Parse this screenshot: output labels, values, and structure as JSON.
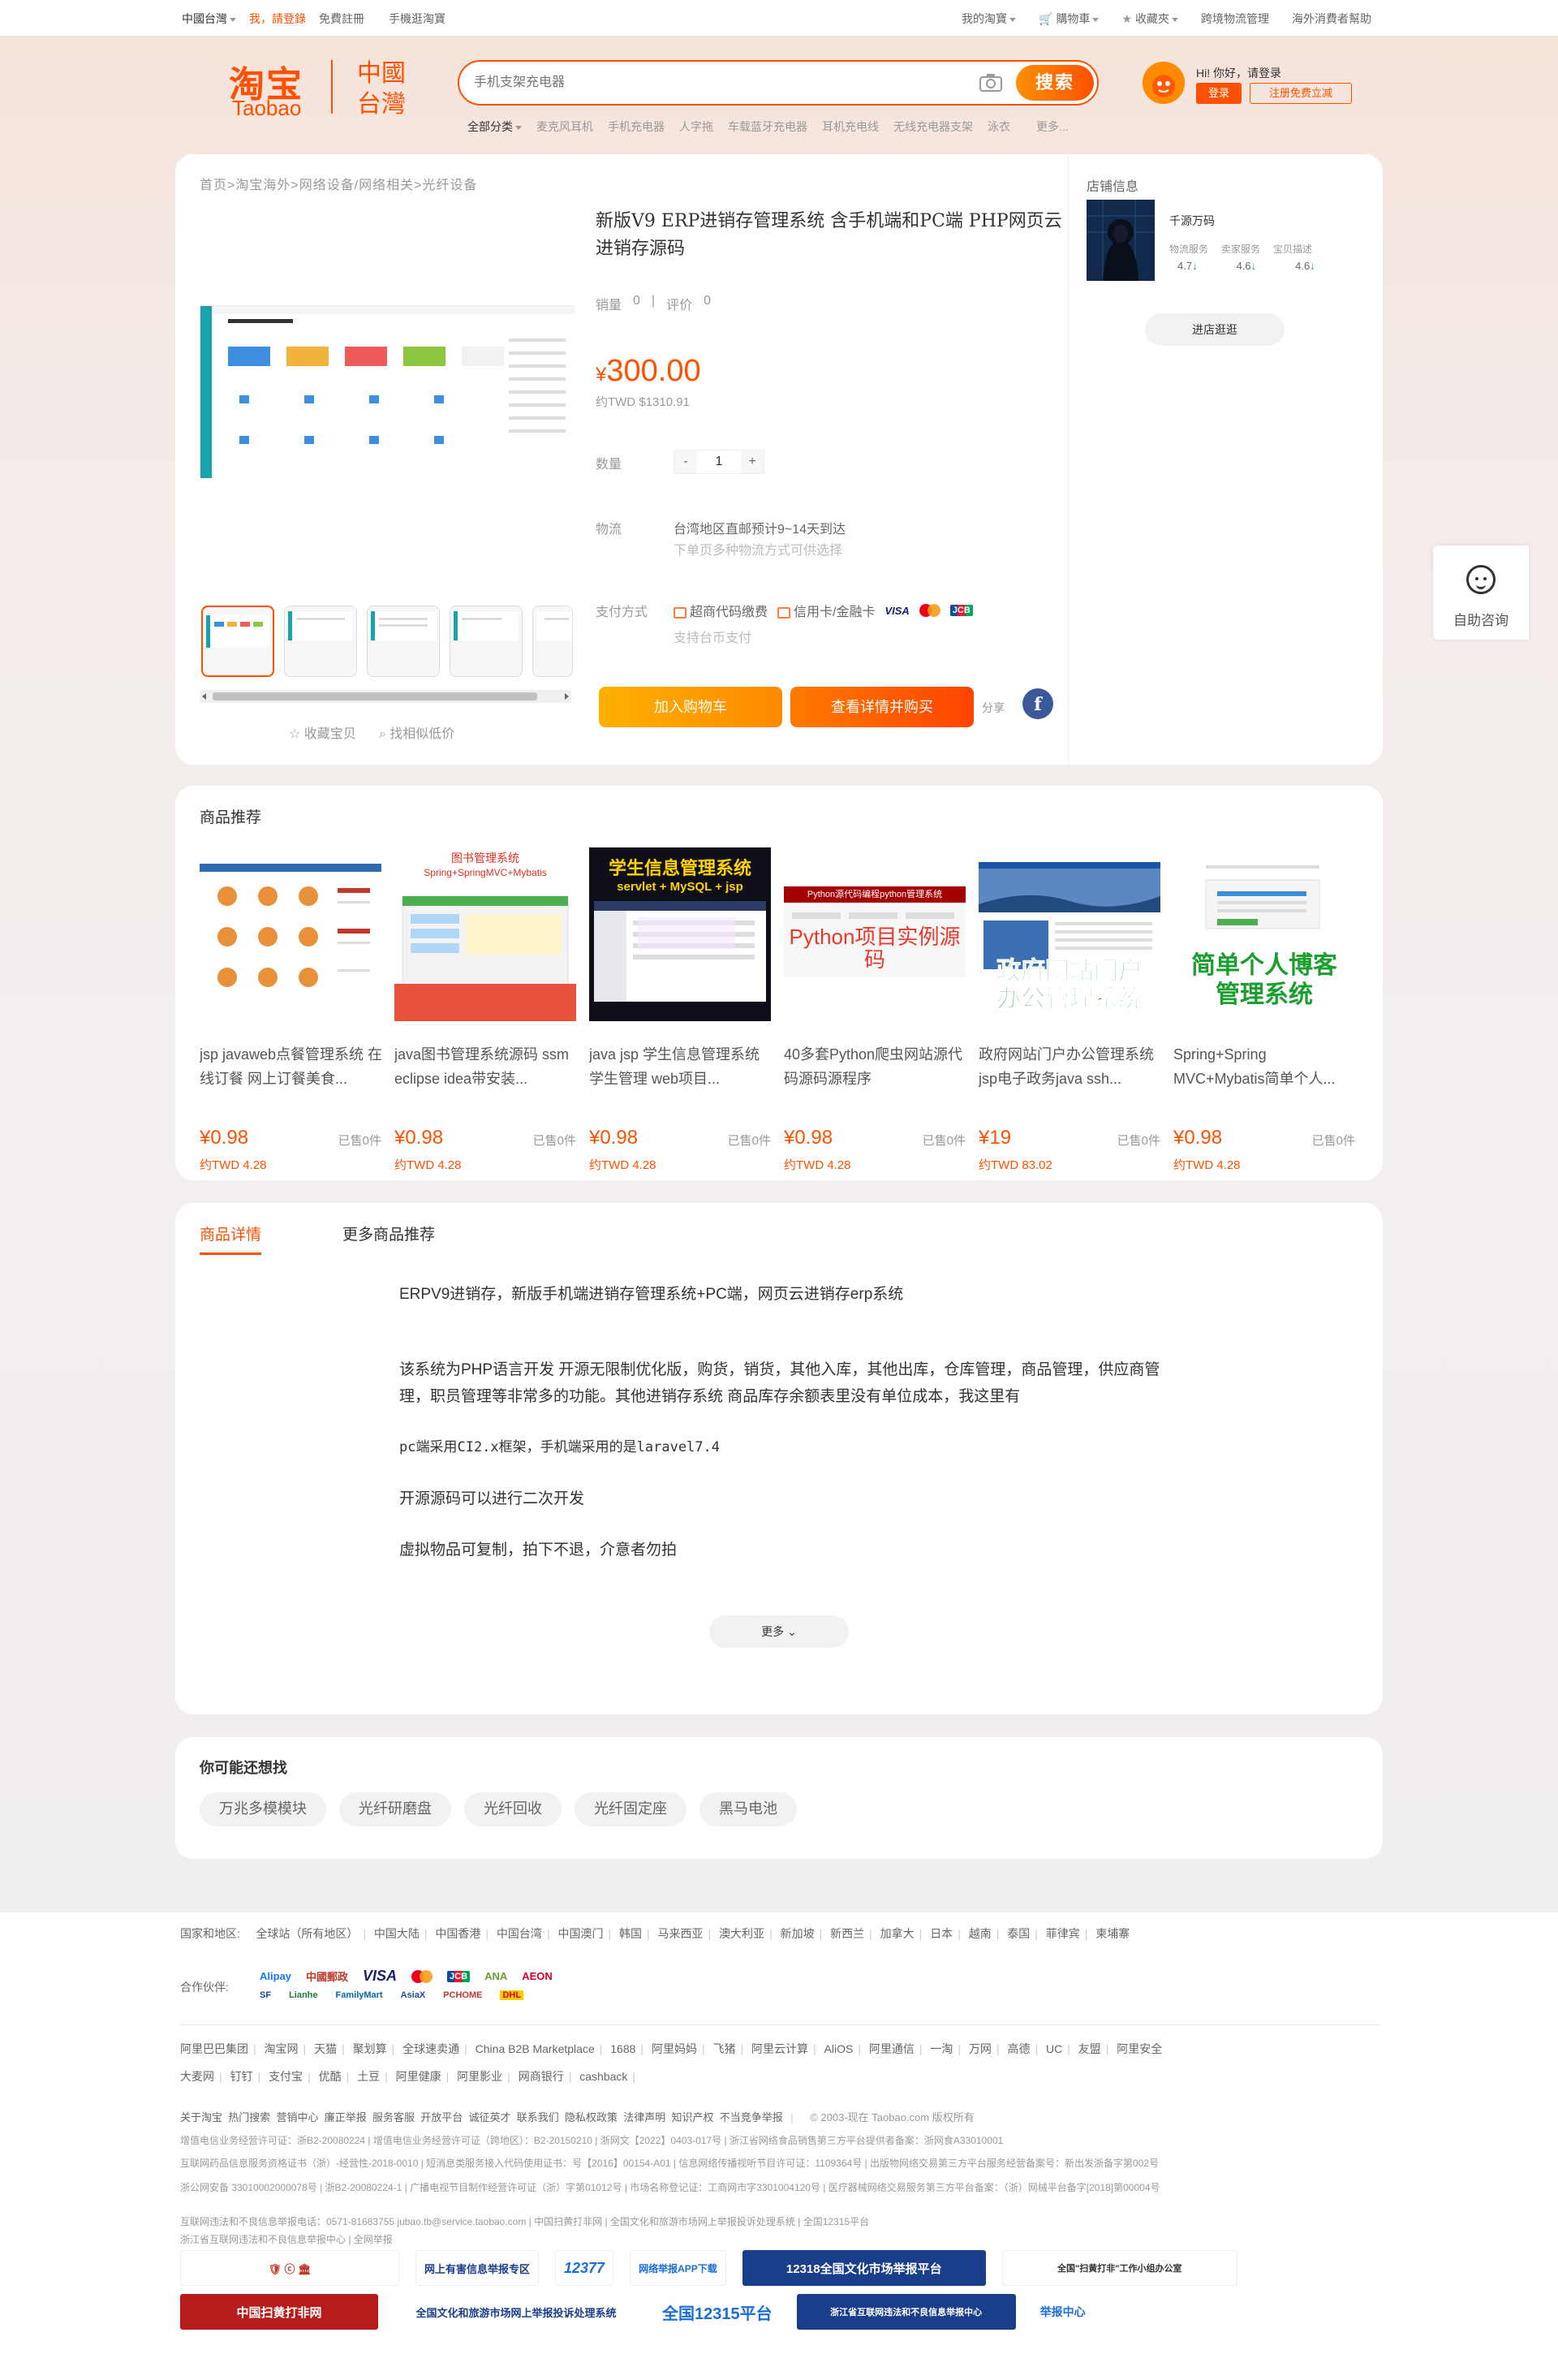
{
  "topbar": {
    "region": "中國台灣",
    "login": "我，請登錄",
    "register": "免費註冊",
    "mobile": "手機逛淘寶",
    "my_taobao": "我的淘寶",
    "cart": "購物車",
    "favorites": "收藏夾",
    "logistics": "跨境物流管理",
    "help": "海外消費者幫助"
  },
  "logo": {
    "cn": "淘宝",
    "en": "Taobao",
    "region_1": "中國",
    "region_2": "台灣"
  },
  "search": {
    "placeholder": "手机支架充电器",
    "button": "搜索"
  },
  "hotwords": {
    "all": "全部分类",
    "items": [
      "麦克风耳机",
      "手机充电器",
      "人字拖",
      "车载蓝牙充电器",
      "耳机充电线",
      "无线充电器支架",
      "泳衣",
      "更多..."
    ]
  },
  "user": {
    "greeting": "Hi! 你好，请登录",
    "login": "登录",
    "register": "注册免费立减"
  },
  "product": {
    "breadcrumb": "首页>淘宝海外>网络设备/网络相关>光纤设备",
    "title": "新版V9 ERP进销存管理系统 含手机端和PC端 PHP网页云进销存源码",
    "sales_label": "销量",
    "sales": "0",
    "review_label": "评价",
    "reviews": "0",
    "price_symbol": "¥",
    "price": "300.00",
    "price_twd": "约TWD $1310.91",
    "qty_label": "数量",
    "qty": "1",
    "ship_label": "物流",
    "ship_line1": "台湾地区直邮预计9~14天到达",
    "ship_line2": "下单页多种物流方式可供选择",
    "pay_label": "支付方式",
    "pay_1": "超商代码缴费",
    "pay_2": "信用卡/金融卡",
    "pay_3": "VISA",
    "pay_4": "JCB",
    "pay_note": "支持台币支付",
    "add_cart": "加入购物车",
    "buy": "查看详情并购买",
    "share": "分享",
    "favorite": "收藏宝贝",
    "find_similar": "找相似低价"
  },
  "shop": {
    "header": "店铺信息",
    "name": "千源万码",
    "stat_labels": [
      "物流服务",
      "卖家服务",
      "宝贝描述"
    ],
    "stat_values": [
      "4.7",
      "4.6",
      "4.6"
    ],
    "enter": "进店逛逛"
  },
  "help_float": {
    "label": "自助咨询"
  },
  "recommend": {
    "title": "商品推荐",
    "items": [
      {
        "name": "jsp javaweb点餐管理系统 在线订餐 网上订餐美食...",
        "price": "¥0.98",
        "sold": "已售0件",
        "twd": "约TWD 4.28",
        "overlay_1": "",
        "overlay_2": ""
      },
      {
        "name": "java图书管理系统源码 ssm eclipse idea带安装...",
        "price": "¥0.98",
        "sold": "已售0件",
        "twd": "约TWD 4.28",
        "overlay_1": "图书管理系统",
        "overlay_2": "Spring+SpringMVC+Mybatis"
      },
      {
        "name": "java jsp 学生信息管理系统 学生管理 web项目...",
        "price": "¥0.98",
        "sold": "已售0件",
        "twd": "约TWD 4.28",
        "overlay_1": "学生信息管理系统",
        "overlay_2": "servlet + MySQL + jsp"
      },
      {
        "name": "40多套Python爬虫网站源代码源码源程序",
        "price": "¥0.98",
        "sold": "已售0件",
        "twd": "约TWD 4.28",
        "overlay_1": "Python源代码编程python管理系统",
        "overlay_2": "Python项目实例源码"
      },
      {
        "name": "政府网站门户办公管理系统jsp电子政务java ssh...",
        "price": "¥19",
        "sold": "已售0件",
        "twd": "约TWD 83.02",
        "overlay_1": "政府网站门户",
        "overlay_2": "办公管理系统"
      },
      {
        "name": "Spring+Spring MVC+Mybatis简单个人...",
        "price": "¥0.98",
        "sold": "已售0件",
        "twd": "约TWD 4.28",
        "overlay_1": "简单个人博客",
        "overlay_2": "管理系统"
      }
    ]
  },
  "detail": {
    "tab_1": "商品详情",
    "tab_2": "更多商品推荐",
    "paragraphs": [
      "ERPV9进销存，新版手机端进销存管理系统+PC端，网页云进销存erp系统",
      "该系统为PHP语言开发 开源无限制优化版，购货，销货，其他入库，其他出库，仓库管理，商品管理，供应商管理，职员管理等非常多的功能。其他进销存系统 商品库存余额表里没有单位成本，我这里有",
      "pc端采用CI2.x框架，手机端采用的是laravel7.4",
      "开源源码可以进行二次开发",
      "虚拟物品可复制，拍下不退，介意者勿拍"
    ],
    "more": "更多"
  },
  "maylike": {
    "title": "你可能还想找",
    "items": [
      "万兆多模模块",
      "光纤研磨盘",
      "光纤回收",
      "光纤固定座",
      "黑马电池"
    ]
  },
  "footer": {
    "regions_label": "国家和地区:",
    "regions": [
      "全球站（所有地区）",
      "中国大陆",
      "中国香港",
      "中国台湾",
      "中国澳门",
      "韩国",
      "马来西亚",
      "澳大利亚",
      "新加坡",
      "新西兰",
      "加拿大",
      "日本",
      "越南",
      "泰国",
      "菲律宾",
      "柬埔寨"
    ],
    "partners_label": "合作伙伴:",
    "partner_logos": [
      "Alipay",
      "中國郵政",
      "VISA",
      "JCB",
      "AEON",
      "ANA",
      "SF",
      "Lianhe",
      "FamilyMart",
      "AsiaX",
      "PCHOME",
      "DHL"
    ],
    "group_1": [
      "阿里巴巴集团",
      "淘宝网",
      "天猫",
      "聚划算",
      "全球速卖通",
      "China B2B Marketplace",
      "1688",
      "阿里妈妈",
      "飞猪",
      "阿里云计算",
      "AliOS",
      "阿里通信",
      "一淘",
      "万网",
      "高德",
      "UC",
      "友盟",
      "阿里安全"
    ],
    "group_2": [
      "大麦网",
      "钉钉",
      "支付宝",
      "优酷",
      "土豆",
      "阿里健康",
      "阿里影业",
      "网商银行",
      "cashback"
    ],
    "links": [
      "关于淘宝",
      "热门搜索",
      "营销中心",
      "廉正举报",
      "服务客服",
      "开放平台",
      "诚征英才",
      "联系我们",
      "隐私权政策",
      "法律声明",
      "知识产权",
      "不当竞争举报"
    ],
    "copyright": "© 2003-现在 Taobao.com 版权所有",
    "license_1": "增值电信业务经营许可证：浙B2-20080224 | 增值电信业务经营许可证（跨地区）：B2-20150210 | 浙网文【2022】0403-017号 | 浙江省网络食品销售第三方平台提供者备案：浙网食A33010001",
    "license_2": "互联网药品信息服务资格证书（浙）-经营性-2018-0010 | 短消息类服务接入代码使用证书：号【2016】00154-A01 | 信息网络传播视听节目许可证：1109364号 | 出版物网络交易第三方平台服务经营备案号：新出发浙备字第002号",
    "license_3": "浙公网安备 33010002000078号 | 浙B2-20080224-1 | 广播电视节目制作经营许可证（浙）字第01012号 | 市场名称登记证：工商网市字3301004120号 | 医疗器械网络交易服务第三方平台备案：（浙）网械平台备字[2018]第00004号",
    "license_4": "互联网违法和不良信息举报电话：0571-81683755 jubao.tb@service.taobao.com | 中国扫黄打非网 | 全国文化和旅游市场网上举报投诉处理系统 | 全国12315平台",
    "license_5": "浙江省互联网违法和不良信息举报中心 | 全网举报",
    "badges": [
      "网上有害信息举报专区",
      "12377",
      "网络举报APP下载",
      "12318全国文化市场举报平台",
      "全国\"扫黄打非\"工作小组办公室",
      "中国扫黄打非网",
      "全国文化和旅游市场网上举报投诉处理系统",
      "全国12315平台",
      "浙江省互联网违法和不良信息举报中心",
      "举报中心"
    ]
  }
}
